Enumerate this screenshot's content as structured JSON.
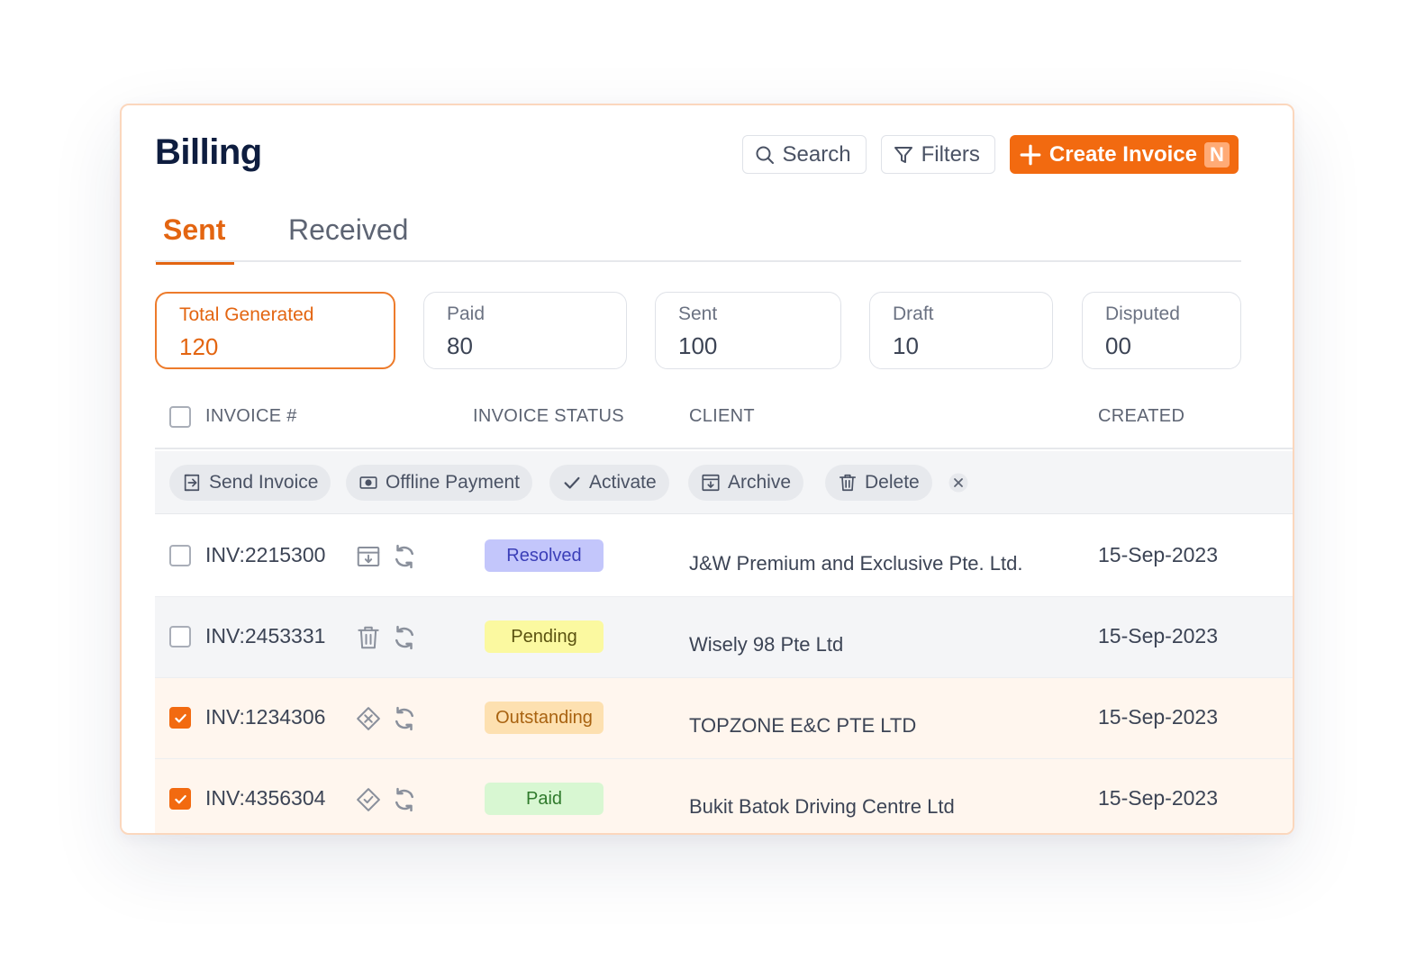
{
  "page": {
    "title": "Billing"
  },
  "toolbar": {
    "search_label": "Search",
    "filters_label": "Filters",
    "create_label": "Create Invoice",
    "create_shortcut": "N"
  },
  "tabs": [
    {
      "label": "Sent",
      "active": true
    },
    {
      "label": "Received",
      "active": false
    }
  ],
  "stats": [
    {
      "label": "Total Generated",
      "value": "120",
      "active": true
    },
    {
      "label": "Paid",
      "value": "80"
    },
    {
      "label": "Sent",
      "value": "100"
    },
    {
      "label": "Draft",
      "value": "10"
    },
    {
      "label": "Disputed",
      "value": "00"
    }
  ],
  "table": {
    "headers": {
      "invoice": "INVOICE #",
      "status": "INVOICE STATUS",
      "client": "CLIENT",
      "created": "CREATED"
    },
    "actions": [
      "Send Invoice",
      "Offline Payment",
      "Activate",
      "Archive",
      "Delete"
    ],
    "rows": [
      {
        "invoice": "INV:2215300",
        "status": "Resolved",
        "client": "J&W Premium and Exclusive Pte. Ltd.",
        "created": "15-Sep-2023",
        "checked": false,
        "row_icon": "archive-icon"
      },
      {
        "invoice": "INV:2453331",
        "status": "Pending",
        "client": "Wisely 98 Pte Ltd",
        "created": "15-Sep-2023",
        "checked": false,
        "row_icon": "trash-icon"
      },
      {
        "invoice": "INV:1234306",
        "status": "Outstanding",
        "client": "TOPZONE E&C PTE LTD",
        "created": "15-Sep-2023",
        "checked": true,
        "row_icon": "diamond-x-icon"
      },
      {
        "invoice": "INV:4356304",
        "status": "Paid",
        "client": "Bukit Batok Driving Centre Ltd",
        "created": "15-Sep-2023",
        "checked": true,
        "row_icon": "diamond-check-icon"
      }
    ]
  },
  "colors": {
    "accent": "#f26a10",
    "resolved_bg": "#c3c6fb",
    "resolved_fg": "#3b3fb8",
    "pending_bg": "#fbf9a0",
    "pending_fg": "#5a5210",
    "outstanding_bg": "#fde0b0",
    "outstanding_fg": "#a86210",
    "paid_bg": "#d8f7d2",
    "paid_fg": "#2f7a2c"
  }
}
